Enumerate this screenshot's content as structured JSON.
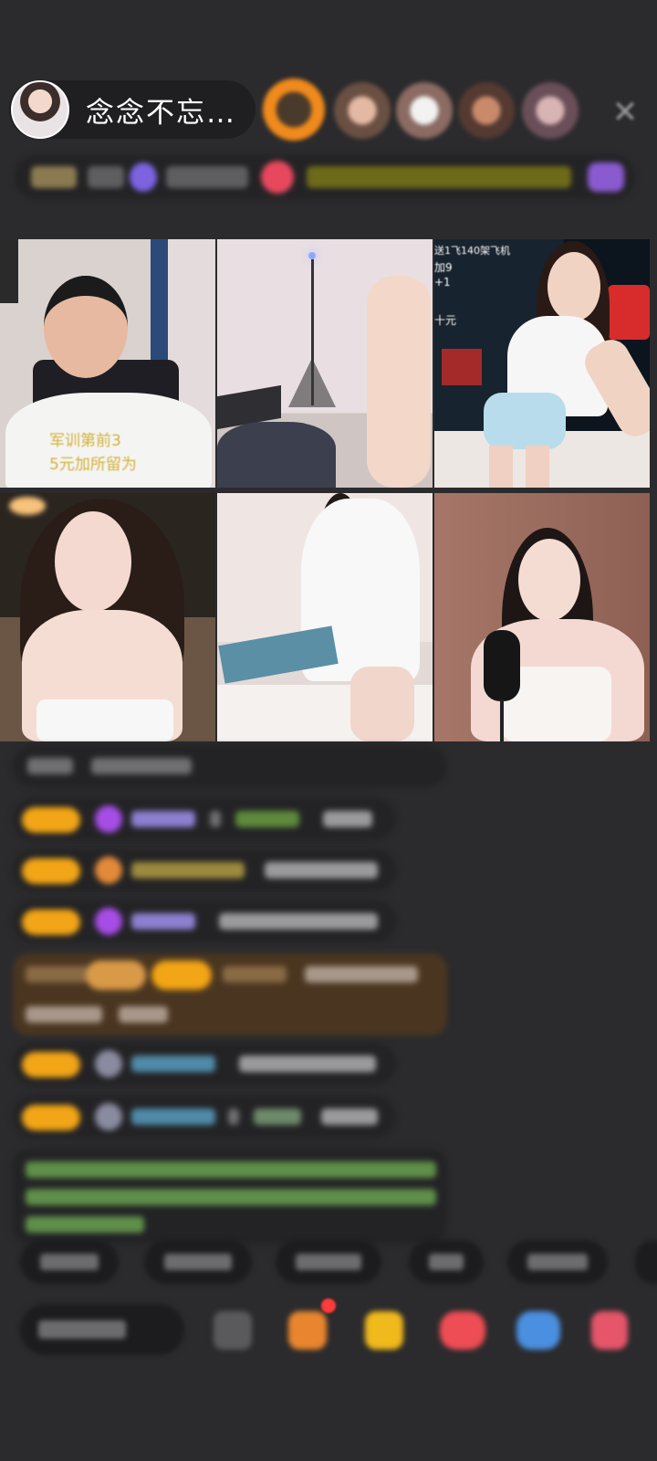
{
  "header": {
    "host_name": "念念不忘…",
    "close_icon": "close-icon"
  },
  "grid": {
    "tiles": [
      {
        "overlay_lines": [
          "军训第前3",
          "5元加所留为"
        ]
      },
      {
        "overlay_lines": []
      },
      {
        "overlay_lines": [
          "送1飞140架飞机",
          "加9",
          "+1",
          "十元"
        ]
      },
      {
        "overlay_lines": []
      },
      {
        "overlay_lines": []
      },
      {
        "overlay_lines": []
      }
    ]
  },
  "colors": {
    "background": "#2b2b2d",
    "badge_orange": "#f2a516",
    "gem_purple": "#a64de6",
    "chat_green": "#8fd26a",
    "chat_blue": "#5ab0d8"
  }
}
